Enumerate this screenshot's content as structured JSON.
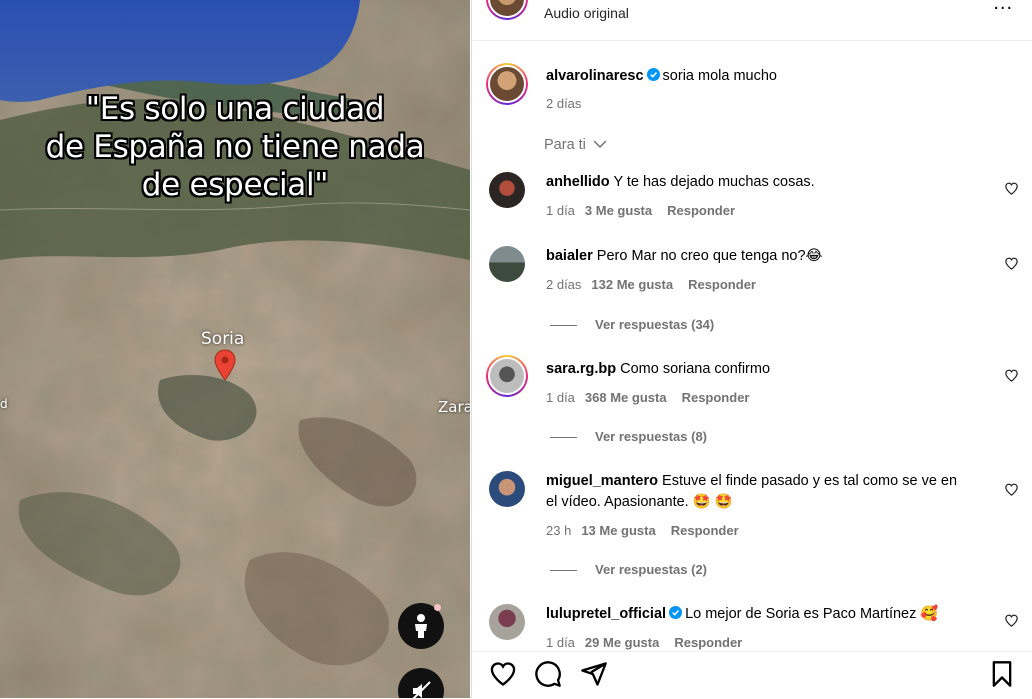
{
  "media": {
    "overlay_lines": [
      "\"Es solo una ciudad",
      "de España no tiene nada",
      "de especial\""
    ],
    "map_labels": {
      "city": "Soria",
      "right_edge": "Zara",
      "left_edge": "d"
    }
  },
  "header": {
    "audio_label": "Audio original",
    "more_label": "..."
  },
  "post": {
    "username": "alvarolinaresc",
    "caption": "soria mola mucho",
    "time": "2 días"
  },
  "sort": {
    "label": "Para ti"
  },
  "comments": [
    {
      "username": "anhellido",
      "text": "Y te has dejado muchas cosas.",
      "time": "1 día",
      "likes": "3 Me gusta",
      "reply": "Responder"
    },
    {
      "username": "baialer",
      "text": "Pero Mar no creo que tenga no?😂",
      "time": "2 días",
      "likes": "132 Me gusta",
      "reply": "Responder",
      "view_replies": "Ver respuestas (34)"
    },
    {
      "username": "sara.rg.bp",
      "text": "Como soriana confirmo",
      "time": "1 día",
      "likes": "368 Me gusta",
      "reply": "Responder",
      "view_replies": "Ver respuestas (8)"
    },
    {
      "username": "miguel_mantero",
      "text_line1": "Estuve el finde pasado y es tal como se ve en",
      "text_line2": "el vídeo. Apasionante. 🤩 🤩",
      "time": "23 h",
      "likes": "13 Me gusta",
      "reply": "Responder",
      "view_replies": "Ver respuestas (2)"
    },
    {
      "username": "lulupretel_official",
      "text": "Lo mejor de Soria es Paco Martínez 🥰",
      "time": "1 día",
      "likes": "29 Me gusta",
      "reply": "Responder"
    }
  ],
  "colors": {
    "link_blue": "#0095f6",
    "muted": "#737373",
    "pin_red": "#ea4335"
  },
  "icons": [
    "like-icon",
    "comment-icon",
    "share-icon",
    "save-icon",
    "heart-small-icon",
    "verified-icon",
    "chevron-down-icon",
    "person-icon",
    "mute-icon",
    "more-icon",
    "map-pin-icon"
  ]
}
